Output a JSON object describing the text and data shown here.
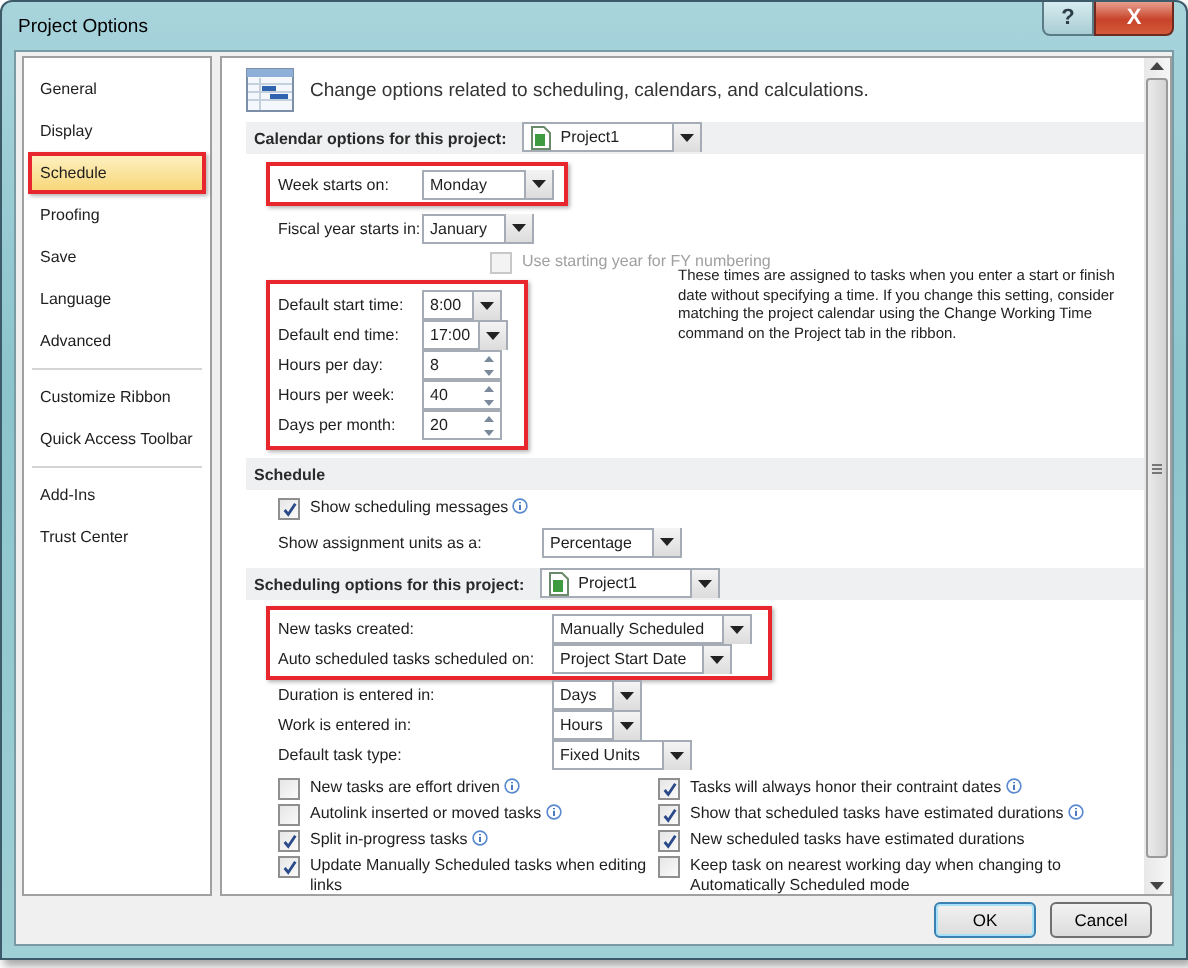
{
  "window": {
    "title": "Project Options",
    "help": "?",
    "close": "X"
  },
  "sidebar": {
    "groups": [
      [
        {
          "label": "General",
          "selected": false,
          "highlighted": false
        },
        {
          "label": "Display",
          "selected": false,
          "highlighted": false
        },
        {
          "label": "Schedule",
          "selected": true,
          "highlighted": true
        },
        {
          "label": "Proofing",
          "selected": false,
          "highlighted": false
        },
        {
          "label": "Save",
          "selected": false,
          "highlighted": false
        },
        {
          "label": "Language",
          "selected": false,
          "highlighted": false
        },
        {
          "label": "Advanced",
          "selected": false,
          "highlighted": false
        }
      ],
      [
        {
          "label": "Customize Ribbon",
          "selected": false,
          "highlighted": false
        },
        {
          "label": "Quick Access Toolbar",
          "selected": false,
          "highlighted": false
        }
      ],
      [
        {
          "label": "Add-Ins",
          "selected": false,
          "highlighted": false
        },
        {
          "label": "Trust Center",
          "selected": false,
          "highlighted": false
        }
      ]
    ]
  },
  "header": "Change options related to scheduling, calendars, and calculations.",
  "calendar": {
    "title": "Calendar options for this project:",
    "project": "Project1",
    "week": {
      "label": "Week starts on:",
      "value": "Monday",
      "highlighted": true
    },
    "fiscal": {
      "label": "Fiscal year starts in:",
      "value": "January"
    },
    "fy_numbering": {
      "label": "Use starting year for FY numbering",
      "checked": false,
      "disabled": true
    },
    "times": {
      "highlighted": true,
      "rows": [
        {
          "kind": "dropdown",
          "label": "Default start time:",
          "value": "8:00"
        },
        {
          "kind": "dropdown",
          "label": "Default end time:",
          "value": "17:00"
        },
        {
          "kind": "spin",
          "label": "Hours per day:",
          "value": "8"
        },
        {
          "kind": "spin",
          "label": "Hours per week:",
          "value": "40"
        },
        {
          "kind": "spin",
          "label": "Days per month:",
          "value": "20"
        }
      ]
    },
    "note": "These times are assigned to tasks when you enter a start or finish date without specifying a time. If you change this setting, consider matching the project calendar using the Change Working Time command on the Project tab in the ribbon."
  },
  "schedule": {
    "title": "Schedule",
    "messages": {
      "label": "Show scheduling messages",
      "checked": true,
      "disabled": false,
      "info": true
    },
    "units": {
      "label": "Show assignment units as a:",
      "value": "Percentage"
    }
  },
  "scheduling": {
    "title": "Scheduling options for this project:",
    "project": "Project1",
    "highlighted_rows": {
      "highlighted": true,
      "rows": [
        {
          "label": "New tasks created:",
          "value": "Manually Scheduled"
        },
        {
          "label": "Auto scheduled tasks scheduled on:",
          "value": "Project Start Date"
        }
      ]
    },
    "rows": [
      {
        "label": "Duration is entered in:",
        "value": "Days"
      },
      {
        "label": "Work is entered in:",
        "value": "Hours"
      },
      {
        "label": "Default task type:",
        "value": "Fixed Units"
      }
    ],
    "checks_left": [
      {
        "label": "New tasks are effort driven",
        "checked": false,
        "disabled": false,
        "info": true
      },
      {
        "label": "Autolink inserted or moved tasks",
        "checked": false,
        "disabled": false,
        "info": true
      },
      {
        "label": "Split in-progress tasks",
        "checked": true,
        "disabled": false,
        "info": true
      },
      {
        "label": "Update Manually Scheduled tasks when editing links",
        "checked": true,
        "disabled": false,
        "info": false
      }
    ],
    "checks_right": [
      {
        "label": "Tasks will always honor their contraint dates",
        "checked": true,
        "disabled": false,
        "info": true
      },
      {
        "label": "Show that scheduled tasks have estimated durations",
        "checked": true,
        "disabled": false,
        "info": true
      },
      {
        "label": "New scheduled tasks have estimated durations",
        "checked": true,
        "disabled": false,
        "info": false
      },
      {
        "label": "Keep task on nearest working day when changing to Automatically Scheduled mode",
        "checked": false,
        "disabled": false,
        "info": false
      }
    ]
  },
  "buttons": [
    {
      "label": "OK",
      "default": true
    },
    {
      "label": "Cancel",
      "default": false
    }
  ]
}
